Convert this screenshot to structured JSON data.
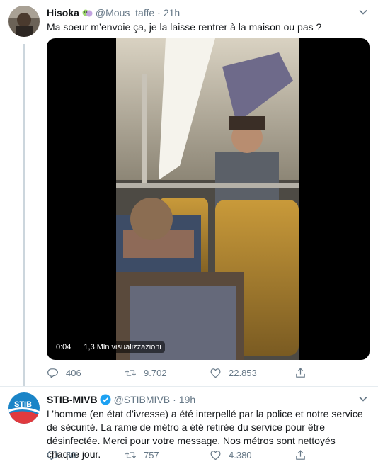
{
  "tweets": [
    {
      "name": "Hisoka",
      "handle": "@Mous_taffe",
      "separator": "·",
      "time": "21h",
      "text": "Ma soeur m’envoie ça, je la laisse rentrer à la maison ou pas ?",
      "video": {
        "time": "0:04",
        "views": "1,3 Mln visualizzazioni"
      },
      "stats": {
        "replies": "406",
        "retweets": "9.702",
        "likes": "22.853"
      }
    },
    {
      "name": "STIB-MIVB",
      "handle": "@STIBMIVB",
      "separator": "·",
      "time": "19h",
      "text": "L’homme (en état d’ivresse) a été interpellé par la police et notre service de sécurité. La rame de métro a été retirée du service pour être désinfectée. Merci pour votre message. Nos métros sont nettoyés chaque jour.",
      "avatar_text": "STIB",
      "stats": {
        "replies": "50",
        "retweets": "757",
        "likes": "4.380"
      }
    }
  ],
  "colors": {
    "accent": "#1da1f2",
    "muted": "#657786",
    "text": "#14171a",
    "border": "#e6ecf0"
  },
  "icons": [
    "reply-icon",
    "retweet-icon",
    "like-icon",
    "share-icon",
    "chevron-down-icon",
    "verified-badge-icon"
  ]
}
